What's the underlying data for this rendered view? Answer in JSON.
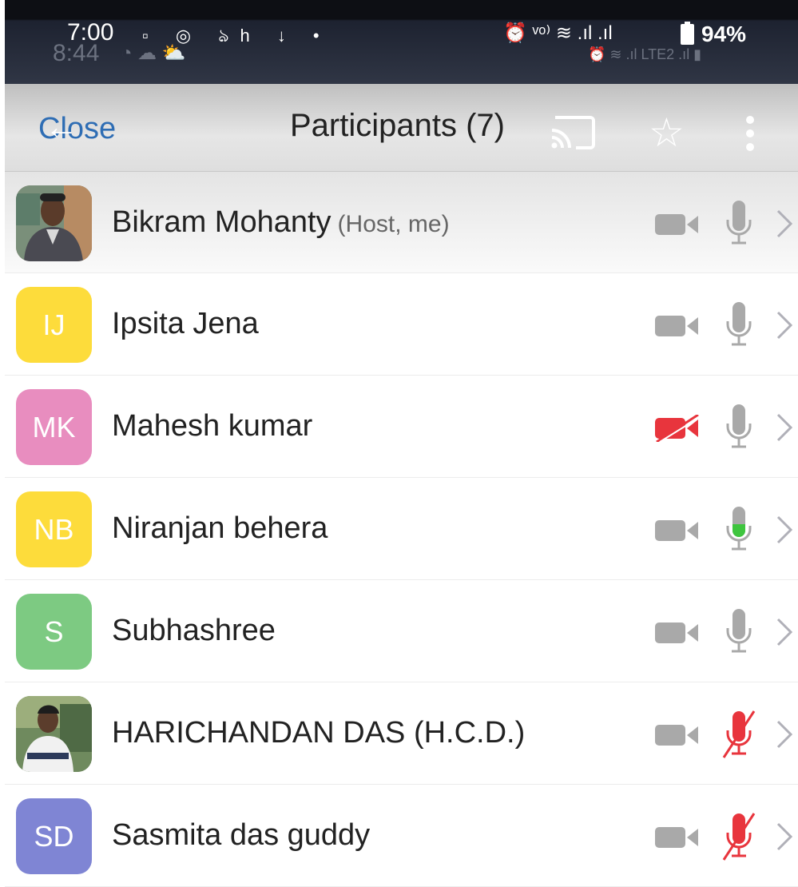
{
  "status_bar": {
    "time": "7:00",
    "ghost_time": "8:44",
    "left_icons": "▫ ◎ ঌh ↓ •",
    "right_icons": "⏰ ᵛᵒ⁾ ≋ .ıl .ıl",
    "battery_percent": "94%",
    "ghost_icons": "⏰ ≋ .ıl LTE2 .ıl ▮"
  },
  "header": {
    "close_label": "Close",
    "back_glyph": "←",
    "title": "Participants (7)",
    "icons": [
      "cast-icon",
      "star-icon",
      "more-vertical-icon"
    ]
  },
  "participants": [
    {
      "name": "Bikram Mohanty",
      "suffix": "(Host, me)",
      "initials": "",
      "avatar_color": "#8a6d55",
      "photo": true,
      "video": "on",
      "audio": "on"
    },
    {
      "name": "Ipsita Jena",
      "suffix": "",
      "initials": "IJ",
      "avatar_color": "#fddc3b",
      "photo": false,
      "video": "on",
      "audio": "on"
    },
    {
      "name": "Mahesh kumar",
      "suffix": "",
      "initials": "MK",
      "avatar_color": "#e88dbf",
      "photo": false,
      "video": "off",
      "audio": "on"
    },
    {
      "name": "Niranjan behera",
      "suffix": "",
      "initials": "NB",
      "avatar_color": "#fddc3b",
      "photo": false,
      "video": "on",
      "audio": "speaking"
    },
    {
      "name": "Subhashree",
      "suffix": "",
      "initials": "S",
      "avatar_color": "#7dca82",
      "photo": false,
      "video": "on",
      "audio": "on"
    },
    {
      "name": "HARICHANDAN DAS (H.C.D.)",
      "suffix": "",
      "initials": "",
      "avatar_color": "#6f8a5e",
      "photo": true,
      "video": "on",
      "audio": "muted"
    },
    {
      "name": "Sasmita das guddy",
      "suffix": "",
      "initials": "SD",
      "avatar_color": "#7f85d4",
      "photo": false,
      "video": "on",
      "audio": "muted"
    }
  ],
  "colors": {
    "accent_blue": "#2e6db4",
    "icon_gray": "#a9a9a9",
    "muted_red": "#e8353d",
    "speaking_green": "#3ec53e"
  }
}
